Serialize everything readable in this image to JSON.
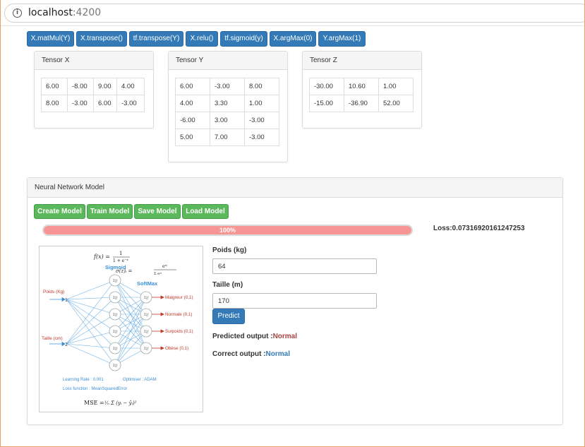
{
  "browser": {
    "host": "localhost",
    "port": ":4200"
  },
  "toolbar": [
    {
      "label": "X.matMul(Y)"
    },
    {
      "label": "X.transpose()"
    },
    {
      "label": "tf.transpose(Y)"
    },
    {
      "label": "X.relu()"
    },
    {
      "label": "tf.sigmoid(y)"
    },
    {
      "label": "X.argMax(0)"
    },
    {
      "label": "Y.argMax(1)"
    }
  ],
  "tensors": {
    "x": {
      "title": "Tensor X",
      "rows": [
        [
          "6.00",
          "-8.00",
          "9.00",
          "4.00"
        ],
        [
          "8.00",
          "-3.00",
          "6.00",
          "-3.00"
        ]
      ]
    },
    "y": {
      "title": "Tensor Y",
      "rows": [
        [
          "6.00",
          "-3.00",
          "8.00"
        ],
        [
          "4.00",
          "3.30",
          "1.00"
        ],
        [
          "-6.00",
          "3.00",
          "-3.00"
        ],
        [
          "5.00",
          "7.00",
          "-3.00"
        ]
      ]
    },
    "z": {
      "title": "Tensor Z",
      "rows": [
        [
          "-30.00",
          "10.60",
          "1.00"
        ],
        [
          "-15.00",
          "-36.90",
          "52.00"
        ]
      ]
    }
  },
  "model": {
    "title": "Neural Network Model",
    "buttons": {
      "create": "Create Model",
      "train": "Train Model",
      "save": "Save Model",
      "load": "Load Model"
    },
    "progress": {
      "value": 1.0,
      "label": "100%"
    },
    "loss_text": "Loss:0.07316920161247253",
    "form": {
      "weight_label": "Poids (kg)",
      "weight_value": "64",
      "height_label": "Taille (m)",
      "height_value": "170",
      "predict_label": "Predict"
    },
    "predicted": {
      "label": "Predicted output :",
      "value": "Normal"
    },
    "correct": {
      "label": "Correct output :",
      "value": "Normal"
    }
  },
  "diagram": {
    "f_label": "f(x) =",
    "sigmoid_title": "Sigmoid",
    "softmax_title": "SoftMax",
    "input_weight": "Poids (Kg)",
    "input_height": "Taille (cm)",
    "in1": "1",
    "in2": "2",
    "outputs": [
      "Maigreur (0,1)",
      "Normale (0,1)",
      "Surpoids (0,1)",
      "Obèse (0,1)"
    ],
    "lr": "Learning Rate : 0.001",
    "optimizer": "Optimiser : ADAM",
    "loss_fn": "Loss function : MeanSquaredError",
    "mse_label": "MSE ="
  },
  "colors": {
    "primary": "#337ab7",
    "success": "#5cb85c",
    "progress": "#f79494",
    "red": "#a94442"
  }
}
